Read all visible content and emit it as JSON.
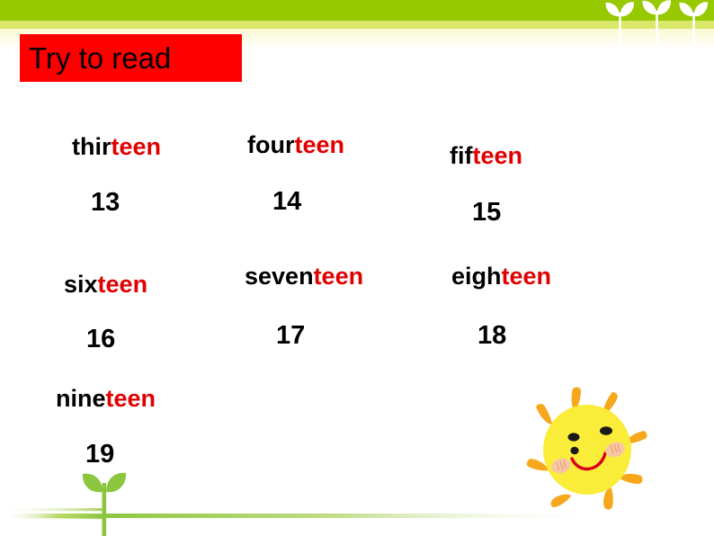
{
  "slide": {
    "title": "Try to read",
    "title_bg_color": "#fe0000",
    "title_text_color": "#000000",
    "accent_red": "#e00000",
    "banner_green": "#97c900",
    "banner_light_green": "#d9e86b",
    "banner_cream": "#fbfad4",
    "sun_body_color": "#faed3a",
    "sun_ray_color": "#f4a81d",
    "sun_smile_color": "#d8001c",
    "sun_cheek_color": "#f7b89a",
    "sprout_color": "#8cc63e"
  },
  "decorations": {
    "top_sprouts_icon": "sprout-icon",
    "bottom_sprout_icon": "sprout-icon",
    "sun_icon": "smiling-sun-icon"
  },
  "words": [
    {
      "prefix": "thir",
      "suffix": "teen",
      "number": "13"
    },
    {
      "prefix": "four",
      "suffix": "teen",
      "number": "14"
    },
    {
      "prefix": "fif",
      "suffix": "teen",
      "number": "15"
    },
    {
      "prefix": "six",
      "suffix": "teen",
      "number": "16"
    },
    {
      "prefix": "seven",
      "suffix": "teen",
      "number": "17"
    },
    {
      "prefix": "eigh",
      "suffix": "teen",
      "number": "18"
    },
    {
      "prefix": "nine",
      "suffix": "teen",
      "number": "19"
    }
  ]
}
